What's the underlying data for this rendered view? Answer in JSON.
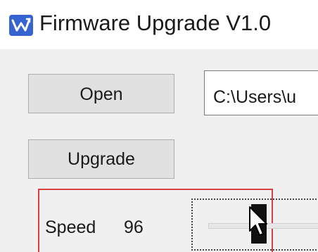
{
  "window": {
    "title": "Firmware Upgrade V1.0",
    "icon": "app-logo-icon"
  },
  "controls": {
    "open_label": "Open",
    "upgrade_label": "Upgrade",
    "file_path": "C:\\Users\\u"
  },
  "speed": {
    "label": "Speed",
    "value": "96",
    "slider_fraction": 0.4
  },
  "colors": {
    "highlight": "#d8413f",
    "icon_blue": "#3563d0"
  },
  "icons": {
    "cursor": "mouse-pointer-icon"
  }
}
